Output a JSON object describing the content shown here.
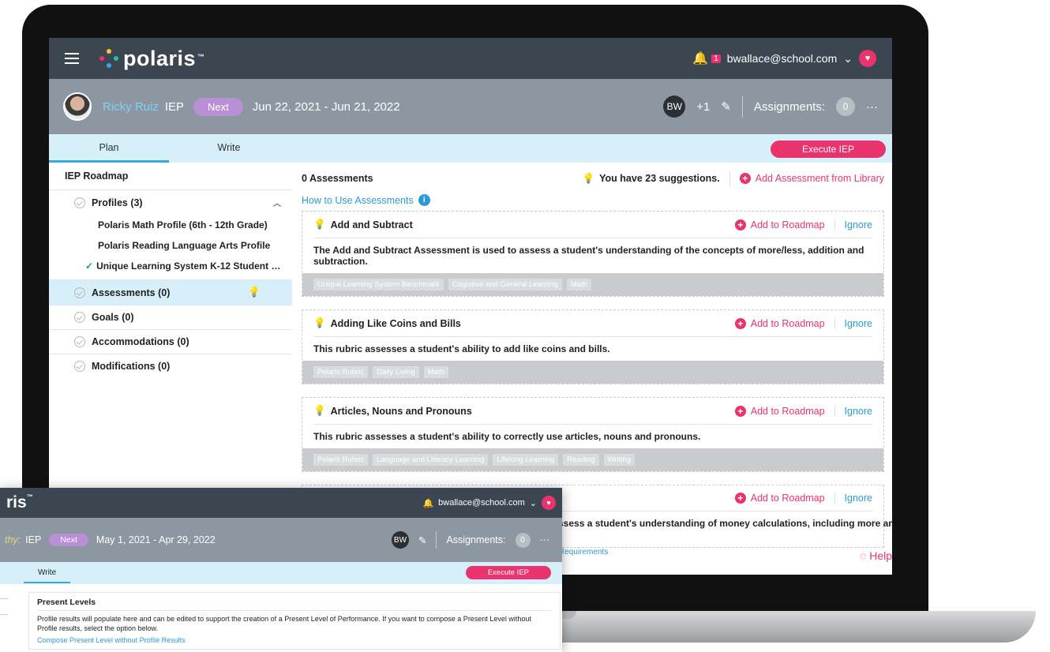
{
  "app": {
    "logo_text": "polaris",
    "logo_sup": "™",
    "user_email": "bwallace@school.com",
    "notification_count": "1"
  },
  "student": {
    "name": "Ricky Ruiz",
    "plan_type": "IEP",
    "status_pill": "Next",
    "date_range": "Jun 22, 2021 - Jun 21, 2022",
    "team_initials": "BW",
    "team_extra": "+1",
    "assignments_label": "Assignments:",
    "assignments_count": "0",
    "more": "···"
  },
  "tabs": [
    {
      "label": "Plan"
    },
    {
      "label": "Write"
    }
  ],
  "execute_label": "Execute IEP",
  "roadmap": {
    "title": "IEP Roadmap",
    "profiles_label": "Profiles (3)",
    "profile_items": [
      "Polaris Math Profile (6th - 12th Grade)",
      "Polaris Reading Language Arts Profile",
      "Unique Learning System K-12 Student Learn..."
    ],
    "assessments_label": "Assessments (0)",
    "goals_label": "Goals (0)",
    "accommodations_label": "Accommodations (0)",
    "modifications_label": "Modifications (0)"
  },
  "main": {
    "title": "0 Assessments",
    "suggestions": "You have 23 suggestions.",
    "add_from_library": "Add Assessment from Library",
    "how_to": "How to Use Assessments",
    "add_to_roadmap": "Add to Roadmap",
    "ignore": "Ignore",
    "cards": [
      {
        "title": "Add and Subtract",
        "desc": "The Add and Subtract Assessment is used to assess a student's understanding of the concepts of more/less, addition and subtraction.",
        "tags": [
          "Unique Learning System Benchmark",
          "Cognitive and General Learning",
          "Math"
        ]
      },
      {
        "title": "Adding Like Coins and Bills",
        "desc": "This rubric assesses a student's ability to add like coins and bills.",
        "tags": [
          "Polaris Rubric",
          "Daily Living",
          "Math"
        ]
      },
      {
        "title": "Articles, Nouns and Pronouns",
        "desc": "This rubric assesses a student's ability to correctly use articles, nouns and pronouns.",
        "tags": [
          "Polaris Rubric",
          "Language and Literacy Learning",
          "Lifelong Learning",
          "Reading",
          "Writing"
        ]
      }
    ],
    "partial_card_desc": "ssess a student's understanding of money calculations, including more and",
    "footer_link": "Requirements",
    "help": "Help"
  },
  "overlay": {
    "logo_text": "ris",
    "logo_sup": "™",
    "user_email": "bwallace@school.com",
    "name_fragment": "thy:",
    "plan_type": "IEP",
    "status_pill": "Next",
    "date_range": "May 1, 2021 - Apr 29, 2022",
    "team_initials": "BW",
    "assignments_label": "Assignments:",
    "assignments_count": "0",
    "more": "···",
    "tab_label": "Write",
    "execute_label": "Execute IEP",
    "section_title": "Present Levels",
    "section_desc": "Profile results will populate here and can be edited to support the creation of a Present Level of Performance. If you want to compose a Present Level without Profile results, select the option below.",
    "section_link": "Compose Present Level without Profile Results"
  }
}
